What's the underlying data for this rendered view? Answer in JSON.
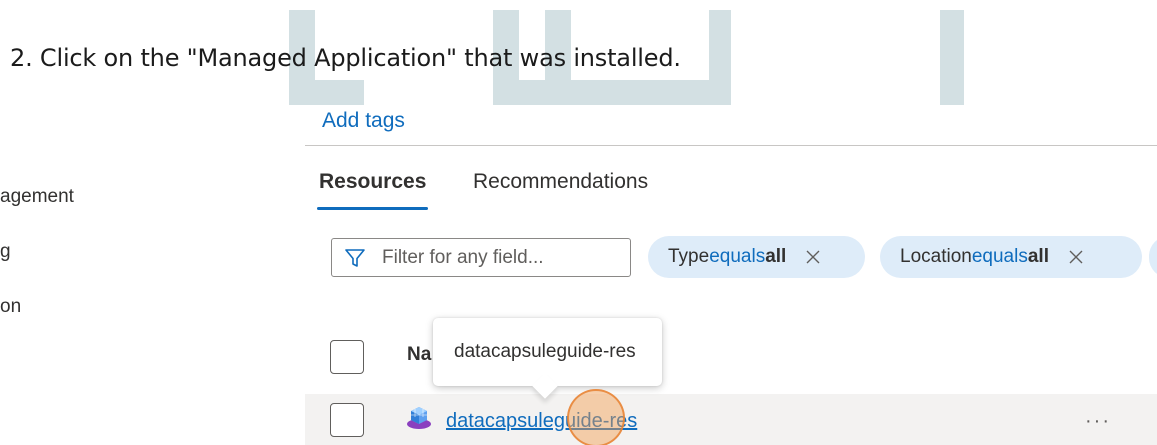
{
  "instruction": {
    "text": "2.  Click on the \"Managed Application\" that was installed."
  },
  "sidebar": {
    "fragments": [
      "agement",
      "g",
      "on"
    ]
  },
  "header": {
    "add_tags": "Add tags"
  },
  "tabs": [
    {
      "label": "Resources",
      "active": true
    },
    {
      "label": "Recommendations",
      "active": false
    }
  ],
  "filter": {
    "placeholder": "Filter for any field...",
    "pills": [
      {
        "prefix": "Type ",
        "keyword": "equals",
        "value": " all"
      },
      {
        "prefix": "Location ",
        "keyword": "equals",
        "value": " all"
      }
    ]
  },
  "table": {
    "column_name": "Na",
    "rows": [
      {
        "name": "datacapsuleguide-res",
        "actions": "···"
      }
    ]
  },
  "tooltip": {
    "text": "datacapsuleguide-res"
  },
  "colors": {
    "accent": "#0f6cbd",
    "pill_bg": "#deecf9",
    "watermark": "#d3e0e3",
    "row_hover": "#f3f2f1"
  }
}
